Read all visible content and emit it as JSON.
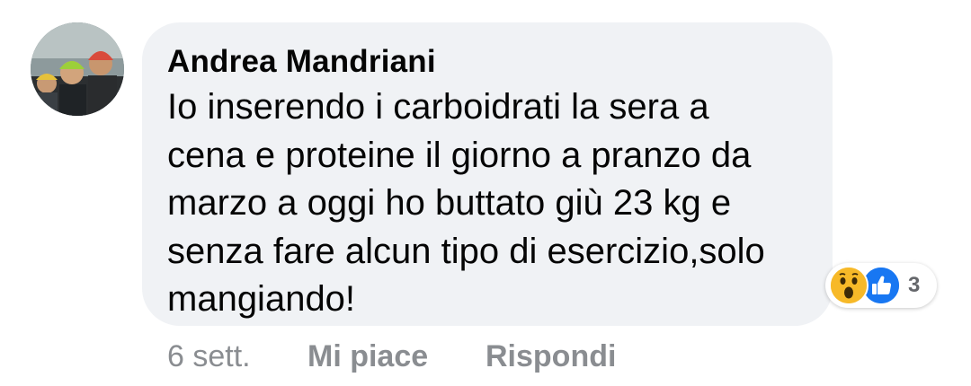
{
  "comment": {
    "author": "Andrea Mandriani",
    "text_lines": [
      "Io inserendo i carboidrati la sera a",
      "cena e proteine il giorno a pranzo da",
      "marzo a oggi ho buttato giù 23 kg e",
      "senza fare alcun tipo di esercizio,solo",
      "mangiando!"
    ],
    "reactions": {
      "icons": [
        "wow-icon",
        "like-icon"
      ],
      "count": "3"
    },
    "timestamp": "6 sett.",
    "like_label": "Mi piace",
    "reply_label": "Rispondi"
  },
  "colors": {
    "bubble": "#f0f2f5",
    "text": "#050505",
    "meta": "#8a8d91",
    "like_blue": "#1877f2",
    "wow_yellow": "#f7b928"
  }
}
